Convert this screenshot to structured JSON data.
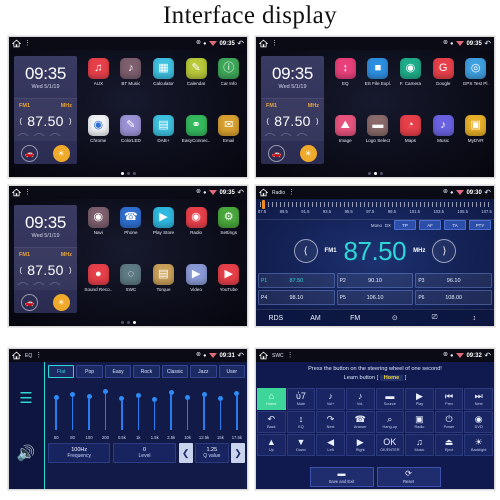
{
  "title": "Interface display",
  "statusbar": {
    "bt_icon": "bluetooth-icon",
    "gps_icon": "location-icon",
    "wifi_icon": "wifi-icon",
    "back_icon": "back-icon",
    "home_icon": "home-icon",
    "menu_icon": "overflow-menu-icon"
  },
  "widget": {
    "time": "09:35",
    "date": "Wed 5/1/19",
    "band": "FM1",
    "unit": "MHz",
    "freq": "87.50",
    "prev_icon": "prev-icon",
    "next_icon": "next-icon",
    "car_icon": "car-icon",
    "weather_icon": "weather-icon"
  },
  "panels": [
    {
      "name": "home-page-1",
      "time": "09:35",
      "app_title": "",
      "page_index": 0,
      "pages": 3,
      "apps": [
        {
          "label": "AUX",
          "icon": "aux-icon",
          "glyph": "♫",
          "color": "#e8404a"
        },
        {
          "label": "BT Music",
          "icon": "bt-music-icon",
          "glyph": "♪",
          "color": "#7d5f6e"
        },
        {
          "label": "Calculator",
          "icon": "calculator-icon",
          "glyph": "▦",
          "color": "#3fc1e0"
        },
        {
          "label": "Calendar",
          "icon": "calendar-icon",
          "glyph": "✎",
          "color": "#b9c93a"
        },
        {
          "label": "Car Info",
          "icon": "car-info-icon",
          "glyph": "ⓘ",
          "color": "#3fa85b"
        },
        {
          "label": "Chrome",
          "icon": "chrome-icon",
          "glyph": "◉",
          "color": "#f2f4f8"
        },
        {
          "label": "ColorLED",
          "icon": "colorled-icon",
          "glyph": "✎",
          "color": "#9b93d6"
        },
        {
          "label": "DAB+",
          "icon": "dab-icon",
          "glyph": "▤",
          "color": "#3fc1e0"
        },
        {
          "label": "EasyConnec..",
          "icon": "easyconnect-icon",
          "glyph": "⚭",
          "color": "#35b95e"
        },
        {
          "label": "Email",
          "icon": "email-icon",
          "glyph": "✉",
          "color": "#d9a130"
        }
      ]
    },
    {
      "name": "home-page-2",
      "time": "09:35",
      "page_index": 1,
      "pages": 3,
      "apps": [
        {
          "label": "EQ",
          "icon": "eq-icon",
          "glyph": "↕",
          "color": "#e8407a"
        },
        {
          "label": "ES File Expl.",
          "icon": "es-file-explorer-icon",
          "glyph": "■",
          "color": "#2f8fe0"
        },
        {
          "label": "F. Camera",
          "icon": "front-camera-icon",
          "glyph": "◉",
          "color": "#1fae8a"
        },
        {
          "label": "Google",
          "icon": "google-icon",
          "glyph": "G",
          "color": "#e8404a"
        },
        {
          "label": "GPS Test Pl.",
          "icon": "gps-test-icon",
          "glyph": "◎",
          "color": "#3fa0e0"
        },
        {
          "label": "Image",
          "icon": "image-icon",
          "glyph": "⛰",
          "color": "#e8547e"
        },
        {
          "label": "Logo Select",
          "icon": "logo-select-icon",
          "glyph": "▬",
          "color": "#8a6a6a"
        },
        {
          "label": "Maps",
          "icon": "maps-icon",
          "glyph": "◔",
          "color": "#e8404a"
        },
        {
          "label": "Music",
          "icon": "music-icon",
          "glyph": "♪",
          "color": "#6a62e0"
        },
        {
          "label": "MyDVR",
          "icon": "mydvr-icon",
          "glyph": "▣",
          "color": "#e8b02a"
        }
      ]
    },
    {
      "name": "home-page-3",
      "time": "09:35",
      "page_index": 2,
      "pages": 3,
      "apps": [
        {
          "label": "Navi",
          "icon": "navi-icon",
          "glyph": "◉",
          "color": "#7d5f6e"
        },
        {
          "label": "Phone",
          "icon": "phone-icon",
          "glyph": "☎",
          "color": "#2f6fd0"
        },
        {
          "label": "Play Store",
          "icon": "play-store-icon",
          "glyph": "▶",
          "color": "#2fb8e0"
        },
        {
          "label": "Radio",
          "icon": "radio-icon",
          "glyph": "◉",
          "color": "#e8404a"
        },
        {
          "label": "Settings",
          "icon": "settings-icon",
          "glyph": "⚙",
          "color": "#4aa83c"
        },
        {
          "label": "Sound Reco..",
          "icon": "sound-recorder-icon",
          "glyph": "●",
          "color": "#e8404a"
        },
        {
          "label": "SWC",
          "icon": "swc-icon",
          "glyph": "◌",
          "color": "#5e7a84"
        },
        {
          "label": "Torque",
          "icon": "torque-icon",
          "glyph": "▤",
          "color": "#c9a15a"
        },
        {
          "label": "Video",
          "icon": "video-icon",
          "glyph": "▶",
          "color": "#8a9ad6"
        },
        {
          "label": "YouTube",
          "icon": "youtube-icon",
          "glyph": "▶",
          "color": "#e8404a"
        }
      ]
    }
  ],
  "radio": {
    "app_title": "Radio",
    "time": "09:30",
    "scale_labels": [
      "87.5",
      "89.5",
      "91.5",
      "93.5",
      "95.5",
      "97.5",
      "99.5",
      "101.5",
      "103.5",
      "105.5",
      "107.5"
    ],
    "mode_mono": "Mono",
    "mode_dx": "DX",
    "mode_buttons": [
      "TP",
      "AF",
      "TA",
      "PTY"
    ],
    "band": "FM1",
    "frequency": "87.50",
    "unit": "MHz",
    "prev_icon": "prev-icon",
    "next_icon": "next-icon",
    "presets": [
      {
        "name": "P1",
        "value": "87.50",
        "active": true
      },
      {
        "name": "P2",
        "value": "90.10",
        "active": false
      },
      {
        "name": "P3",
        "value": "96.10",
        "active": false
      },
      {
        "name": "P4",
        "value": "98.10",
        "active": false
      },
      {
        "name": "P5",
        "value": "106.10",
        "active": false
      },
      {
        "name": "P6",
        "value": "108.00",
        "active": false
      }
    ],
    "bottom_bar": [
      {
        "label": "RDS",
        "icon": "rds-label"
      },
      {
        "label": "AM",
        "icon": "am-label"
      },
      {
        "label": "FM",
        "icon": "fm-label"
      },
      {
        "label": "⊙",
        "icon": "scan-icon"
      },
      {
        "label": "⎚",
        "icon": "antenna-icon"
      },
      {
        "label": "↕",
        "icon": "equalizer-icon"
      }
    ]
  },
  "eq": {
    "app_title": "EQ",
    "time": "09:31",
    "side_icons": [
      "equalizer-icon",
      "speaker-icon"
    ],
    "presets": [
      {
        "label": "Flat",
        "active": true
      },
      {
        "label": "Pop",
        "active": false
      },
      {
        "label": "Easy",
        "active": false
      },
      {
        "label": "Rock",
        "active": false
      },
      {
        "label": "Classic",
        "active": false
      },
      {
        "label": "Jazz",
        "active": false
      },
      {
        "label": "User",
        "active": false
      }
    ],
    "band_labels": [
      "60",
      "80",
      "100",
      "200",
      "0.5k",
      "1k",
      "1.5k",
      "2.5k",
      "10k",
      "12.5k",
      "15k",
      "17.5k"
    ],
    "band_levels": [
      62,
      68,
      64,
      74,
      60,
      66,
      58,
      72,
      62,
      68,
      60,
      70
    ],
    "frequency_value": "100Hz",
    "frequency_label": "Frequency",
    "level_value": "0",
    "level_label": "Level",
    "q_value": "1.25",
    "q_label": "Q value",
    "prev_icon": "left-arrow-icon",
    "next_icon": "right-arrow-icon"
  },
  "swc": {
    "app_title": "SWC",
    "time": "09:32",
    "message": "Press the button on the steering wheel of one second!",
    "learn_prefix": "Learn button [",
    "learn_value": "Home",
    "learn_suffix": "]",
    "buttons": [
      {
        "label": "Home",
        "icon": "home-icon",
        "glyph": "⌂",
        "active": true
      },
      {
        "label": "Mute",
        "icon": "mute-icon",
        "glyph": "ὐ7",
        "active": false
      },
      {
        "label": "Vol+",
        "icon": "volume-up-icon",
        "glyph": "♪",
        "active": false
      },
      {
        "label": "Vol-",
        "icon": "volume-down-icon",
        "glyph": "♪",
        "active": false
      },
      {
        "label": "Source",
        "icon": "source-icon",
        "glyph": "▬",
        "active": false
      },
      {
        "label": "Play",
        "icon": "play-pause-icon",
        "glyph": "▶",
        "active": false
      },
      {
        "label": "Prev",
        "icon": "previous-track-icon",
        "glyph": "⏮",
        "active": false
      },
      {
        "label": "Next",
        "icon": "next-track-icon",
        "glyph": "⏭",
        "active": false
      },
      {
        "label": "Back",
        "icon": "back-icon",
        "glyph": "↶",
        "active": false
      },
      {
        "label": "EQ",
        "icon": "equalizer-icon",
        "glyph": "↕",
        "active": false
      },
      {
        "label": "Next",
        "icon": "forward-icon",
        "glyph": "↷",
        "active": false
      },
      {
        "label": "Answer",
        "icon": "answer-call-icon",
        "glyph": "☎",
        "active": false
      },
      {
        "label": "Hang-up",
        "icon": "hangup-call-icon",
        "glyph": "⌕",
        "active": false
      },
      {
        "label": "Radio",
        "icon": "radio-icon",
        "glyph": "▣",
        "active": false
      },
      {
        "label": "Power",
        "icon": "power-icon",
        "glyph": "⏻",
        "active": false
      },
      {
        "label": "DVD",
        "icon": "dvd-icon",
        "glyph": "◉",
        "active": false
      },
      {
        "label": "Up",
        "icon": "up-arrow-icon",
        "glyph": "▲",
        "active": false
      },
      {
        "label": "Down",
        "icon": "down-arrow-icon",
        "glyph": "▼",
        "active": false
      },
      {
        "label": "Left",
        "icon": "left-arrow-icon",
        "glyph": "◀",
        "active": false
      },
      {
        "label": "Right",
        "icon": "right-arrow-icon",
        "glyph": "▶",
        "active": false
      },
      {
        "label": "OK/ENTER",
        "icon": "ok-enter-icon",
        "glyph": "OK",
        "active": false
      },
      {
        "label": "Music",
        "icon": "music-icon",
        "glyph": "♫",
        "active": false
      },
      {
        "label": "Eject",
        "icon": "eject-icon",
        "glyph": "⏏",
        "active": false
      },
      {
        "label": "Backlight",
        "icon": "backlight-icon",
        "glyph": "☀",
        "active": false
      }
    ],
    "footer": [
      {
        "label": "Save and Exit",
        "icon": "save-icon",
        "glyph": "▬"
      },
      {
        "label": "Reset",
        "icon": "reset-icon",
        "glyph": "⟳"
      }
    ]
  }
}
